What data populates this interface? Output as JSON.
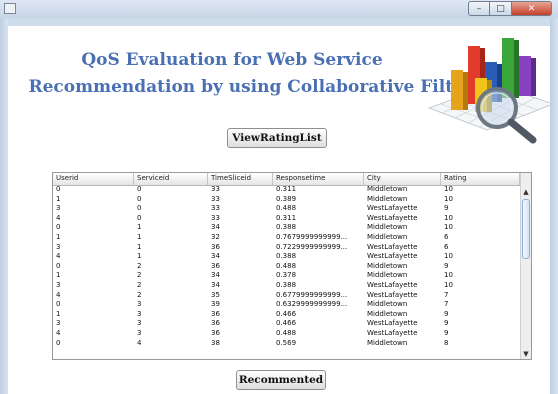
{
  "window": {
    "controls": {
      "minimize": "–",
      "maximize": "□",
      "close": "✕"
    }
  },
  "header": {
    "title_line1": "QoS Evaluation for Web Service",
    "title_line2": "Recommendation by  using Collaborative Filtering",
    "logo_icon": "bar-chart-magnifier-icon",
    "accent_color": "#4a70b4"
  },
  "actions": {
    "view_rating_label": "ViewRatingList",
    "recommend_label": "Recommented"
  },
  "table": {
    "columns": [
      "Userid",
      "Serviceid",
      "TimeSliceid",
      "Responsetime",
      "City",
      "Rating"
    ],
    "rows": [
      [
        "0",
        "0",
        "33",
        "0.311",
        "Middletown",
        "10"
      ],
      [
        "1",
        "0",
        "33",
        "0.389",
        "Middletown",
        "10"
      ],
      [
        "3",
        "0",
        "33",
        "0.488",
        "WestLafayette",
        "9"
      ],
      [
        "4",
        "0",
        "33",
        "0.311",
        "WestLafayette",
        "10"
      ],
      [
        "0",
        "1",
        "34",
        "0.388",
        "Middletown",
        "10"
      ],
      [
        "1",
        "1",
        "32",
        "0.7679999999999...",
        "Middletown",
        "6"
      ],
      [
        "3",
        "1",
        "36",
        "0.7229999999999...",
        "WestLafayette",
        "6"
      ],
      [
        "4",
        "1",
        "34",
        "0.388",
        "WestLafayette",
        "10"
      ],
      [
        "0",
        "2",
        "36",
        "0.488",
        "Middletown",
        "9"
      ],
      [
        "1",
        "2",
        "34",
        "0.378",
        "Middletown",
        "10"
      ],
      [
        "3",
        "2",
        "34",
        "0.388",
        "WestLafayette",
        "10"
      ],
      [
        "4",
        "2",
        "35",
        "0.6779999999999...",
        "WestLafayette",
        "7"
      ],
      [
        "0",
        "3",
        "39",
        "0.6329999999999...",
        "Middletown",
        "7"
      ],
      [
        "1",
        "3",
        "36",
        "0.466",
        "Middletown",
        "9"
      ],
      [
        "3",
        "3",
        "36",
        "0.466",
        "WestLafayette",
        "9"
      ],
      [
        "4",
        "3",
        "36",
        "0.488",
        "WestLafayette",
        "9"
      ],
      [
        "0",
        "4",
        "38",
        "0.569",
        "Middletown",
        "8"
      ]
    ]
  }
}
